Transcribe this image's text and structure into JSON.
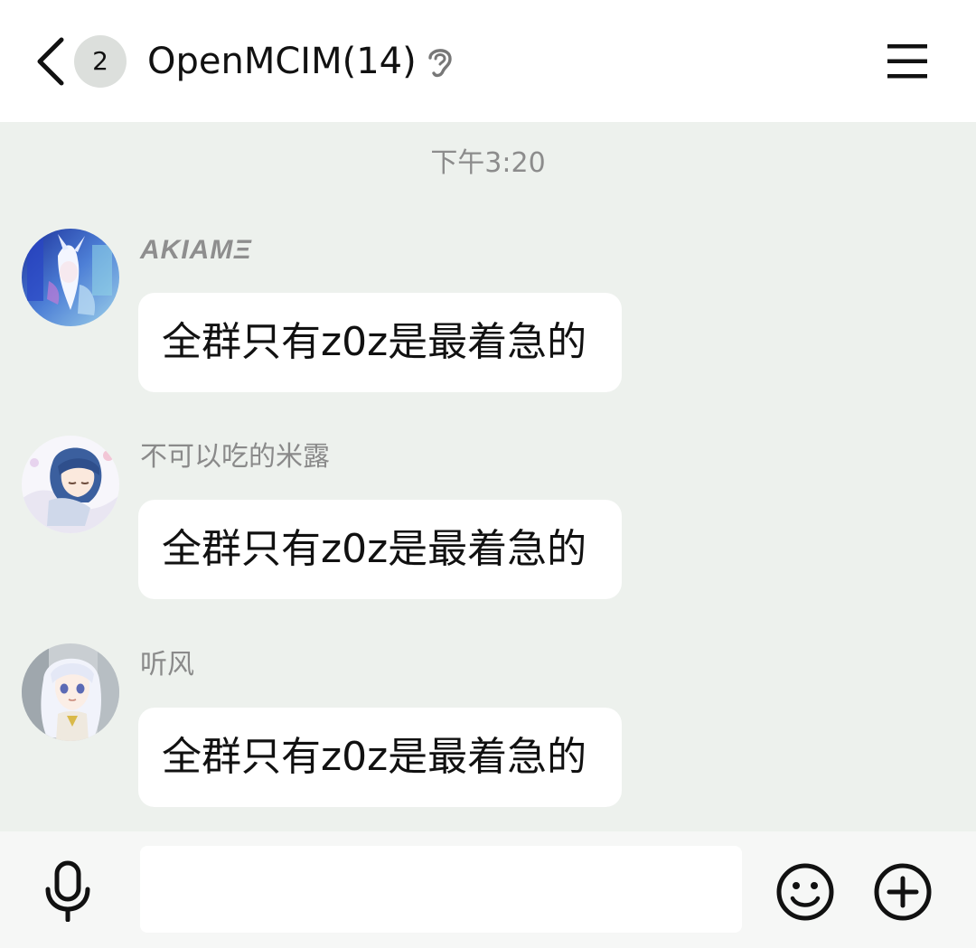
{
  "header": {
    "unread_count": "2",
    "title": "OpenMCIM(14)",
    "back_icon": "chevron-left-icon",
    "earpiece_icon": "ear-icon",
    "menu_icon": "hamburger-menu-icon"
  },
  "chat": {
    "timestamp": "下午3:20",
    "messages": [
      {
        "sender": "AKIAMΞ",
        "text": "全群只有z0z是最着急的"
      },
      {
        "sender": "不可以吃的米露",
        "text": "全群只有z0z是最着急的"
      },
      {
        "sender": "听风",
        "text": "全群只有z0z是最着急的"
      }
    ]
  },
  "input_bar": {
    "placeholder": "",
    "value": "",
    "voice_icon": "microphone-icon",
    "emoji_icon": "smiley-icon",
    "more_icon": "plus-circle-icon"
  },
  "colors": {
    "chat_background": "#edf1ed",
    "bubble_background": "#ffffff",
    "header_background": "#ffffff",
    "input_bar_background": "#f6f7f6",
    "secondary_text": "#8c8c8c"
  }
}
